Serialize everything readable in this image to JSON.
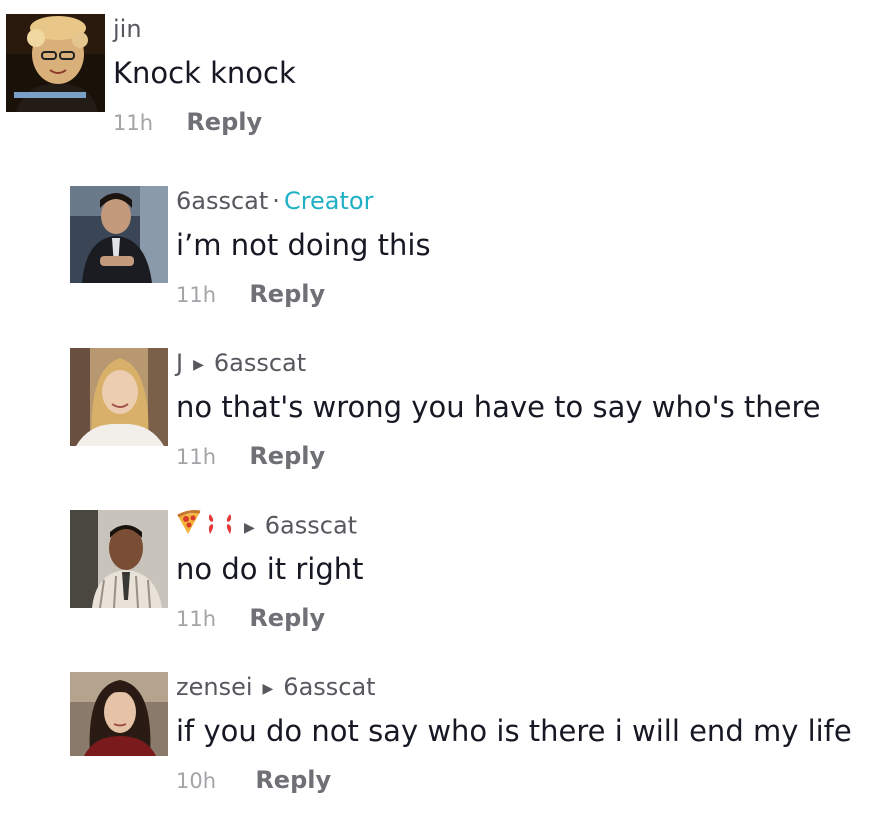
{
  "comments": [
    {
      "username": "jin",
      "text": "Knock knock",
      "time": "11h",
      "reply_label": "Reply"
    },
    {
      "username": "6asscat",
      "creator_separator": "·",
      "creator_badge": "Creator",
      "text": "i’m not doing this",
      "time": "11h",
      "reply_label": "Reply"
    },
    {
      "username": "J",
      "reply_to": "6asscat",
      "text": "no that's wrong you have to say who's there",
      "time": "11h",
      "reply_label": "Reply"
    },
    {
      "username_icons": [
        "pizza-emoji",
        "anger-emoji"
      ],
      "reply_to": "6asscat",
      "text": "no do it right",
      "time": "11h",
      "reply_label": "Reply"
    },
    {
      "username": "zensei",
      "reply_to": "6asscat",
      "text": "if you do not say who is there i will end my life",
      "time": "10h",
      "reply_label": "Reply"
    }
  ],
  "colors": {
    "creator_badge": "#20b0c6",
    "text": "#161823",
    "meta": "#57585e",
    "timestamp": "#a3a4a8"
  }
}
